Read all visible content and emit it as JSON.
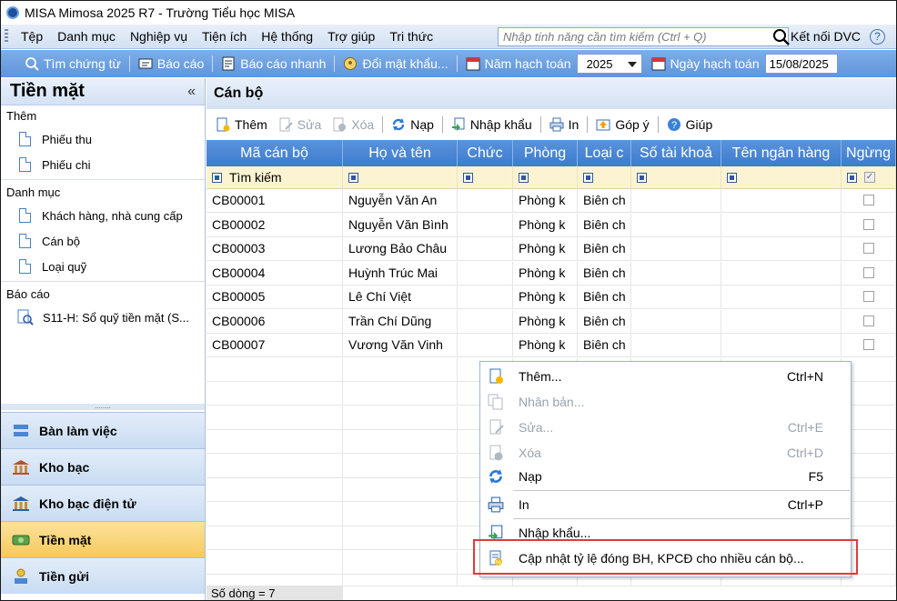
{
  "window": {
    "title": "MISA Mimosa 2025 R7 - Trường Tiểu học MISA"
  },
  "menubar": {
    "items": [
      "Tệp",
      "Danh mục",
      "Nghiệp vụ",
      "Tiện ích",
      "Hệ thống",
      "Trợ giúp",
      "Tri thức"
    ],
    "search_placeholder": "Nhập tính năng cần tìm kiếm (Ctrl + Q)",
    "ketnoi": "Kết nối DVC",
    "help": "?"
  },
  "toolbar": {
    "tim_chung_tu": "Tìm chứng từ",
    "bao_cao": "Báo cáo",
    "bao_cao_nhanh": "Báo cáo nhanh",
    "doi_mat_khau": "Đổi mật khẩu...",
    "nam_hach_toan": "Năm hạch toán",
    "year": "2025",
    "ngay_hach_toan": "Ngày hạch toán",
    "date": "15/08/2025"
  },
  "leftpanel": {
    "title": "Tiền mặt",
    "collapse": "«",
    "groups": {
      "them": "Thêm",
      "danh_muc": "Danh mục",
      "bao_cao": "Báo cáo"
    },
    "items": {
      "phieu_thu": "Phiếu thu",
      "phieu_chi": "Phiếu chi",
      "khach_hang": "Khách hàng, nhà cung cấp",
      "can_bo": "Cán bộ",
      "loai_quy": "Loại quỹ",
      "s11h": "S11-H: Sổ quỹ tiền mặt (S..."
    },
    "splitter": "........",
    "nav": [
      "Bàn làm việc",
      "Kho bạc",
      "Kho bạc điện tử",
      "Tiền mặt",
      "Tiền gửi"
    ]
  },
  "main": {
    "title": "Cán bộ",
    "toolbar": {
      "them": "Thêm",
      "sua": "Sửa",
      "xoa": "Xóa",
      "nap": "Nạp",
      "nhap_khau": "Nhập khẩu",
      "in": "In",
      "gop_y": "Góp ý",
      "giup": "Giúp"
    },
    "columns": [
      "Mã cán bộ",
      "Họ và tên",
      "Chức",
      "Phòng",
      "Loại c",
      "Số tài khoả",
      "Tên ngân hàng",
      "Ngừng"
    ],
    "filter_text": "Tìm kiếm",
    "rows": [
      {
        "ma": "CB00001",
        "ten": "Nguyễn Văn An",
        "phong": "Phòng k",
        "loai": "Biên ch"
      },
      {
        "ma": "CB00002",
        "ten": "Nguyễn Văn Bình",
        "phong": "Phòng k",
        "loai": "Biên ch"
      },
      {
        "ma": "CB00003",
        "ten": "Lương Bảo Châu",
        "phong": "Phòng k",
        "loai": "Biên ch"
      },
      {
        "ma": "CB00004",
        "ten": "Huỳnh Trúc Mai",
        "phong": "Phòng k",
        "loai": "Biên ch"
      },
      {
        "ma": "CB00005",
        "ten": "Lê Chí Việt",
        "phong": "Phòng k",
        "loai": "Biên ch"
      },
      {
        "ma": "CB00006",
        "ten": "Trần Chí Dũng",
        "phong": "Phòng k",
        "loai": "Biên ch"
      },
      {
        "ma": "CB00007",
        "ten": "Vương Văn Vinh",
        "phong": "Phòng k",
        "loai": "Biên ch"
      }
    ],
    "status": "Số dòng = 7"
  },
  "context_menu": {
    "items": [
      {
        "label": "Thêm...",
        "shortcut": "Ctrl+N"
      },
      {
        "label": "Nhân bản...",
        "shortcut": ""
      },
      {
        "label": "Sửa...",
        "shortcut": "Ctrl+E"
      },
      {
        "label": "Xóa",
        "shortcut": "Ctrl+D"
      },
      {
        "label": "Nạp",
        "shortcut": "F5"
      },
      {
        "label": "In",
        "shortcut": "Ctrl+P"
      },
      {
        "label": "Nhập khẩu...",
        "shortcut": ""
      },
      {
        "label": "Cập nhật tỷ lệ đóng BH, KPCĐ cho nhiều cán bộ...",
        "shortcut": ""
      }
    ]
  },
  "colors": {
    "header_blue": "#4a86d4",
    "highlight_red": "#e03b3b",
    "active_nav": "#f7c95c"
  }
}
